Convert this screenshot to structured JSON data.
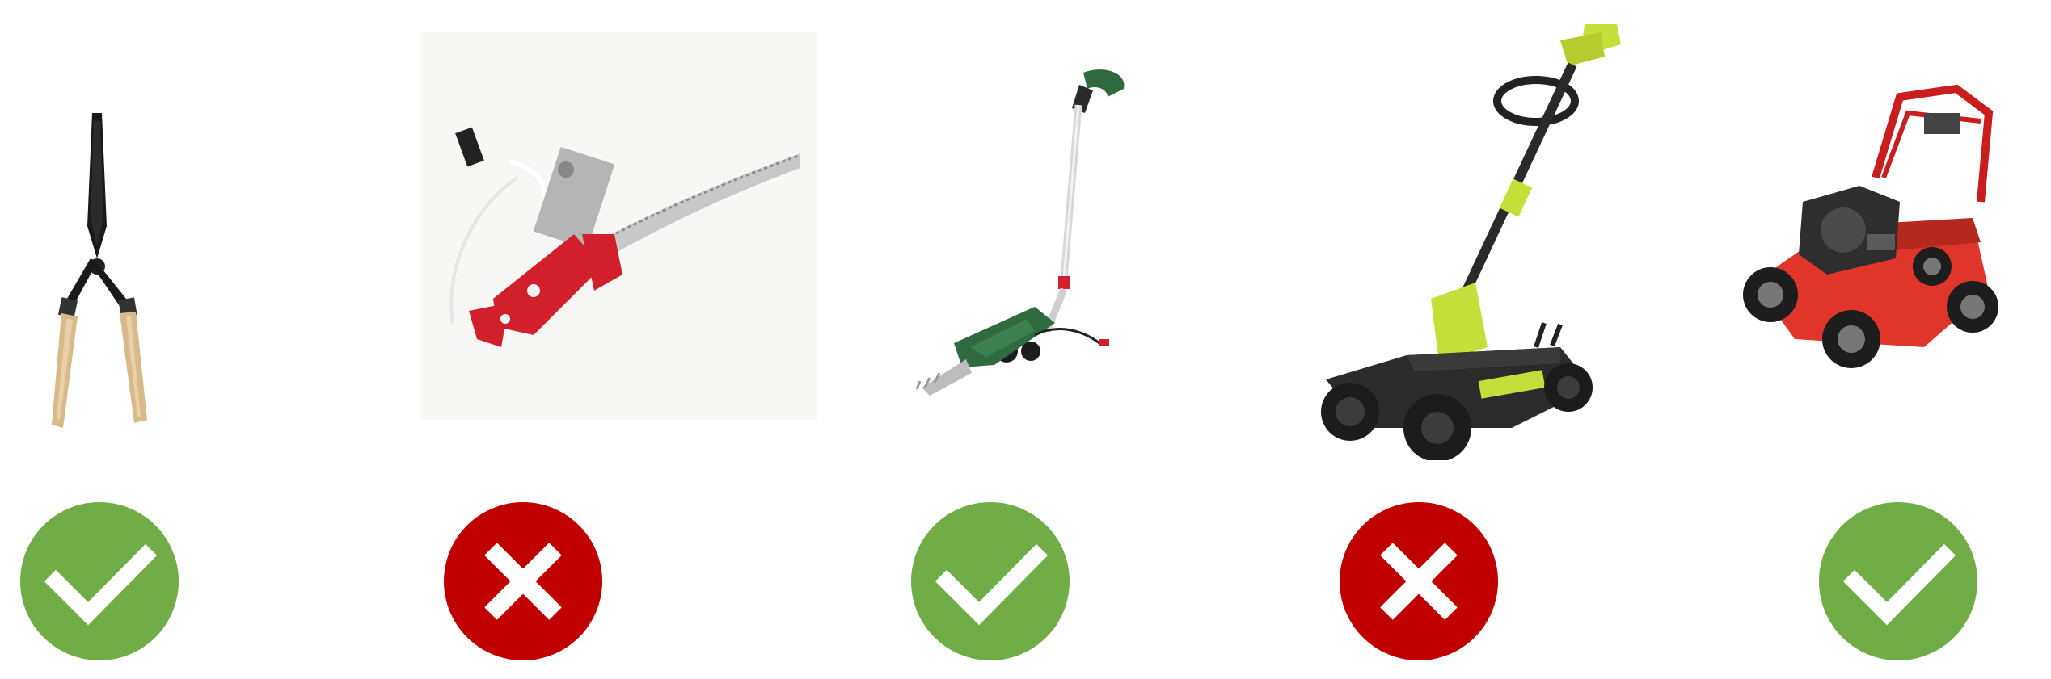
{
  "items": [
    {
      "tool": "hedge-shears",
      "verdict": "check",
      "verdict_color": "#70ad47"
    },
    {
      "tool": "pole-pruner-saw",
      "verdict": "cross",
      "verdict_color": "#c00000"
    },
    {
      "tool": "cordless-grass-shears",
      "verdict": "check",
      "verdict_color": "#70ad47"
    },
    {
      "tool": "string-trimmer-mower",
      "verdict": "cross",
      "verdict_color": "#c00000"
    },
    {
      "tool": "petrol-lawn-mower",
      "verdict": "check",
      "verdict_color": "#70ad47"
    }
  ]
}
